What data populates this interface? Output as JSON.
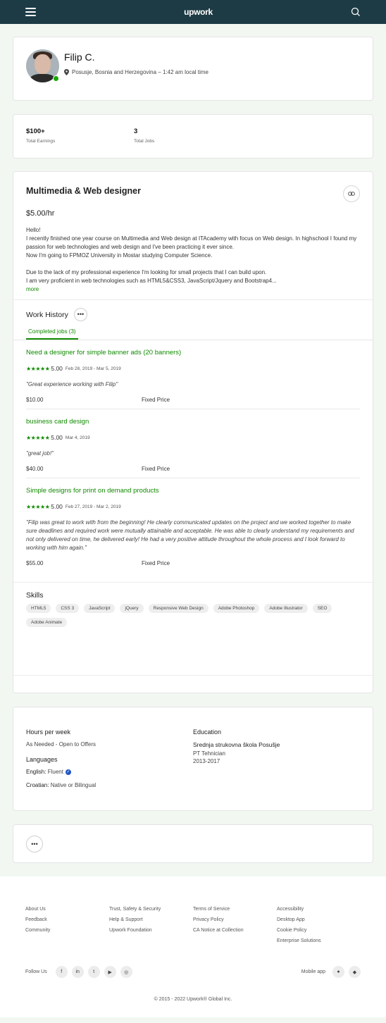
{
  "header": {
    "brand": "upwork",
    "menu_icon": "hamburger-icon",
    "search_icon": "search-icon"
  },
  "profile": {
    "name": "Filip C.",
    "location": "Posusje, Bosnia and Herzegovina – 1:42 am local time",
    "online": true
  },
  "stats": [
    {
      "value": "$100+",
      "label": "Total Earnings"
    },
    {
      "value": "3",
      "label": "Total Jobs"
    }
  ],
  "overview": {
    "title": "Multimedia & Web designer",
    "rate": "$5.00/hr",
    "bio_lines": [
      "Hello!",
      "I recently finished one year course on Multimedia and Web design at ITAcademy with focus on Web design. In highschool I found my passion for web technologies and web design and I've been practicing it ever since.",
      "Now I'm going to FPMOZ University in Mostar studying Computer Science.",
      "",
      "Due to the lack of my professional experience I'm looking for small projects that I can build upon.",
      "I am very proficient in web technologies such as HTML5&CSS3, JavaScript/Jquery and Bootstrap4..."
    ],
    "more_label": "more"
  },
  "work_history": {
    "title": "Work History",
    "tab_label": "Completed jobs (3)",
    "jobs": [
      {
        "title": "Need a designer for simple banner ads (20 banners)",
        "stars": 5,
        "score": "5.00",
        "dates": "Feb 28, 2019 - Mar 5, 2019",
        "feedback": "\"Great experience working with Filip\"",
        "amount": "$10.00",
        "type": "Fixed Price"
      },
      {
        "title": "business card design",
        "stars": 5,
        "score": "5.00",
        "dates": "Mar 4, 2019",
        "feedback": "\"great job!\"",
        "amount": "$40.00",
        "type": "Fixed Price"
      },
      {
        "title": "Simple designs for print on demand products",
        "stars": 5,
        "score": "5.00",
        "dates": "Feb 27, 2019 - Mar 2, 2019",
        "feedback": "\"Filip was great to work with from the beginning! He clearly communicated updates on the project and we worked together to make sure deadlines and required work were mutually attainable and acceptable. He was able to clearly understand my requirements and not only delivered on time, he delivered early! He had a very positive attitude throughout the whole process and I look forward to working with him again.\"",
        "amount": "$55.00",
        "type": "Fixed Price"
      }
    ]
  },
  "skills": {
    "title": "Skills",
    "items": [
      "HTML5",
      "CSS 3",
      "JavaScript",
      "jQuery",
      "Responsive Web Design",
      "Adobe Photoshop",
      "Adobe Illustrator",
      "SEO",
      "Adobe Animate"
    ]
  },
  "details": {
    "hours_title": "Hours per week",
    "hours_value": "As Needed - Open to Offers",
    "languages_title": "Languages",
    "languages": [
      {
        "name": "English:",
        "level": "Fluent",
        "verified": true
      },
      {
        "name": "Croatian:",
        "level": "Native or Bilingual",
        "verified": false
      }
    ],
    "education_title": "Education",
    "school": "Srednja strukovna škola Posušje",
    "degree": "PT Tehnician",
    "years": "2013-2017"
  },
  "footer": {
    "columns": [
      [
        "About Us",
        "Feedback",
        "Community"
      ],
      [
        "Trust, Safety & Security",
        "Help & Support",
        "Upwork Foundation"
      ],
      [
        "Terms of Service",
        "Privacy Policy",
        "CA Notice at Collection"
      ],
      [
        "Accessibility",
        "Desktop App",
        "Cookie Policy",
        "Enterprise Solutions"
      ]
    ],
    "follow_label": "Follow Us",
    "social_icons": [
      "facebook-icon",
      "linkedin-icon",
      "twitter-icon",
      "youtube-icon",
      "instagram-icon"
    ],
    "mobile_label": "Mobile app",
    "copyright": "© 2015 - 2022 Upwork® Global Inc."
  },
  "colors": {
    "header_bg": "#1d3b45",
    "accent": "#108a00",
    "online": "#14a800"
  }
}
